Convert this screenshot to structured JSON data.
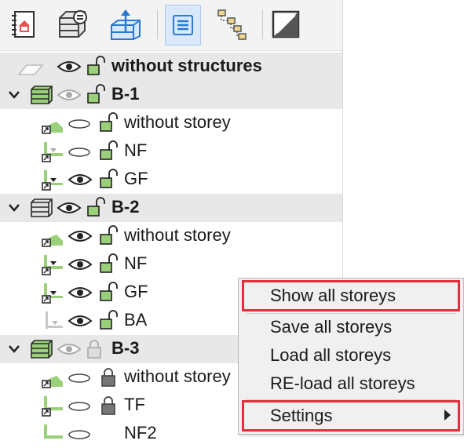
{
  "toolbar": {
    "buttons": [
      "home-project-icon",
      "structure-settings-icon",
      "storey-axis-icon",
      "storey-list-icon",
      "hierarchy-icon",
      "diagonal-toggle-icon"
    ],
    "active_index": 3
  },
  "tree": {
    "rows": [
      {
        "kind": "group",
        "label": "without structures"
      },
      {
        "kind": "group",
        "label": "B-1"
      },
      {
        "kind": "item",
        "label": "without storey"
      },
      {
        "kind": "item",
        "label": "NF"
      },
      {
        "kind": "item",
        "label": "GF"
      },
      {
        "kind": "group",
        "label": "B-2"
      },
      {
        "kind": "item",
        "label": "without storey"
      },
      {
        "kind": "item",
        "label": "NF"
      },
      {
        "kind": "item",
        "label": "GF"
      },
      {
        "kind": "item",
        "label": "BA"
      },
      {
        "kind": "group",
        "label": "B-3"
      },
      {
        "kind": "item",
        "label": "without storey"
      },
      {
        "kind": "item",
        "label": "TF"
      },
      {
        "kind": "item",
        "label": "NF2"
      }
    ]
  },
  "context_menu": {
    "items": [
      "Show all storeys",
      "Save all storeys",
      "Load all storeys",
      "RE-load all storeys",
      "Settings"
    ],
    "highlight_color": "#e0303c"
  },
  "colors": {
    "lock_green": "#9bd07a",
    "group_bg": "#e8e8e8",
    "accent_blue": "#2b78d6"
  }
}
